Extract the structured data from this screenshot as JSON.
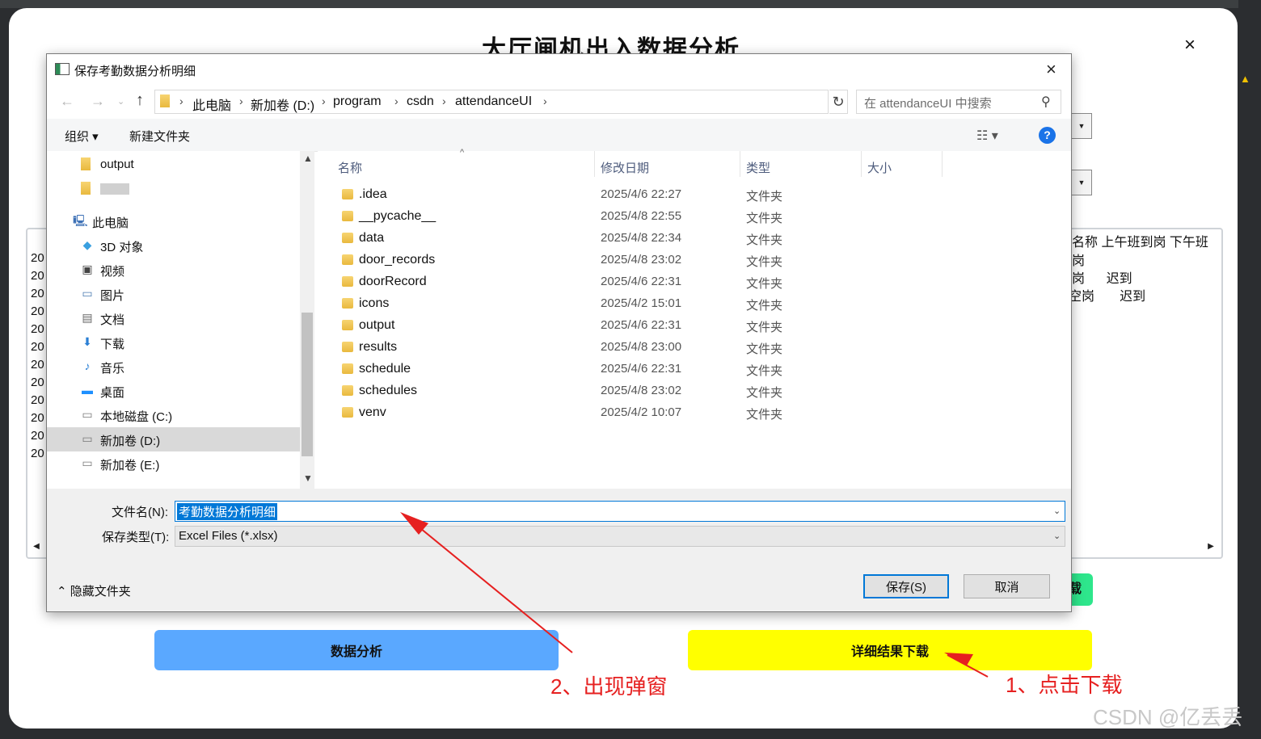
{
  "app": {
    "title": "大厅闸机出入数据分析",
    "close_glyph": "×",
    "right_col_header": "名称  上午班到岗  下午班",
    "right_col_rows": [
      "岗",
      "岗      迟到",
      "空岗       迟到"
    ],
    "year_prefix": "20",
    "green_button_fragment": "载",
    "analyze_button": "数据分析",
    "download_button": "详细结果下载",
    "note_popup": "2、出现弹窗",
    "note_click": "1、点击下载",
    "watermark": "CSDN @亿丢丢"
  },
  "dialog": {
    "title": "保存考勤数据分析明细",
    "close_glyph": "×",
    "breadcrumb": [
      "此电脑",
      "新加卷 (D:)",
      "program",
      "csdn",
      "attendanceUI"
    ],
    "search_placeholder": "在 attendanceUI 中搜索",
    "toolbar": {
      "organize": "组织 ▾",
      "new_folder": "新建文件夹"
    },
    "nav_items": [
      {
        "label": "output",
        "icon": "folder-icon"
      },
      {
        "label": "",
        "icon": "folder-icon"
      },
      {
        "label": "此电脑",
        "icon": "computer-icon"
      },
      {
        "label": "3D 对象",
        "icon": "cube-icon"
      },
      {
        "label": "视频",
        "icon": "video-icon"
      },
      {
        "label": "图片",
        "icon": "picture-icon"
      },
      {
        "label": "文档",
        "icon": "document-icon"
      },
      {
        "label": "下载",
        "icon": "download-icon"
      },
      {
        "label": "音乐",
        "icon": "music-icon"
      },
      {
        "label": "桌面",
        "icon": "desktop-icon"
      },
      {
        "label": "本地磁盘 (C:)",
        "icon": "drive-icon"
      },
      {
        "label": "新加卷 (D:)",
        "icon": "drive-icon"
      },
      {
        "label": "新加卷 (E:)",
        "icon": "drive-icon"
      }
    ],
    "columns": [
      "名称",
      "修改日期",
      "类型",
      "大小"
    ],
    "files": [
      {
        "name": ".idea",
        "date": "2025/4/6 22:27",
        "type": "文件夹"
      },
      {
        "name": "__pycache__",
        "date": "2025/4/8 22:55",
        "type": "文件夹"
      },
      {
        "name": "data",
        "date": "2025/4/8 22:34",
        "type": "文件夹"
      },
      {
        "name": "door_records",
        "date": "2025/4/8 23:02",
        "type": "文件夹"
      },
      {
        "name": "doorRecord",
        "date": "2025/4/6 22:31",
        "type": "文件夹"
      },
      {
        "name": "icons",
        "date": "2025/4/2 15:01",
        "type": "文件夹"
      },
      {
        "name": "output",
        "date": "2025/4/6 22:31",
        "type": "文件夹"
      },
      {
        "name": "results",
        "date": "2025/4/8 23:00",
        "type": "文件夹"
      },
      {
        "name": "schedule",
        "date": "2025/4/6 22:31",
        "type": "文件夹"
      },
      {
        "name": "schedules",
        "date": "2025/4/8 23:02",
        "type": "文件夹"
      },
      {
        "name": "venv",
        "date": "2025/4/2 10:07",
        "type": "文件夹"
      }
    ],
    "filename_label": "文件名(N):",
    "filename_value": "考勤数据分析明细",
    "filetype_label": "保存类型(T):",
    "filetype_value": "Excel Files (*.xlsx)",
    "hide_folders": "隐藏文件夹",
    "save_button": "保存(S)",
    "cancel_button": "取消"
  }
}
